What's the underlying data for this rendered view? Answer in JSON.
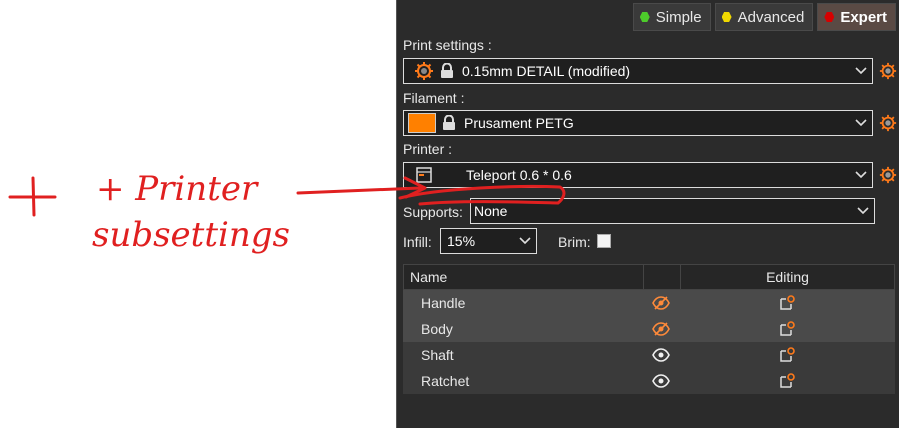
{
  "modes": {
    "simple": {
      "label": "Simple",
      "color": "#4dcc2b"
    },
    "advanced": {
      "label": "Advanced",
      "color": "#f0d800"
    },
    "expert": {
      "label": "Expert",
      "color": "#d60000"
    }
  },
  "print_settings": {
    "label": "Print settings :",
    "value": "0.15mm DETAIL (modified)"
  },
  "filament": {
    "label": "Filament :",
    "value": "Prusament PETG",
    "swatch_color": "#ff8000"
  },
  "printer": {
    "label": "Printer :",
    "value": "Teleport 0.6 * 0.6"
  },
  "supports": {
    "label": "Supports:",
    "value": "None"
  },
  "infill": {
    "label": "Infill:",
    "value": "15%"
  },
  "brim": {
    "label": "Brim:",
    "checked": false
  },
  "objects_table": {
    "headers": {
      "name": "Name",
      "editing": "Editing"
    },
    "rows": [
      {
        "name": "Handle",
        "visibility": "hidden"
      },
      {
        "name": "Body",
        "visibility": "hidden"
      },
      {
        "name": "Shaft",
        "visibility": "visible"
      },
      {
        "name": "Ratchet",
        "visibility": "visible"
      }
    ]
  },
  "annotation": {
    "line1": "+ Printer",
    "line2": "subsettings",
    "color": "#e02020"
  },
  "accent_color": "#ff7a1a"
}
